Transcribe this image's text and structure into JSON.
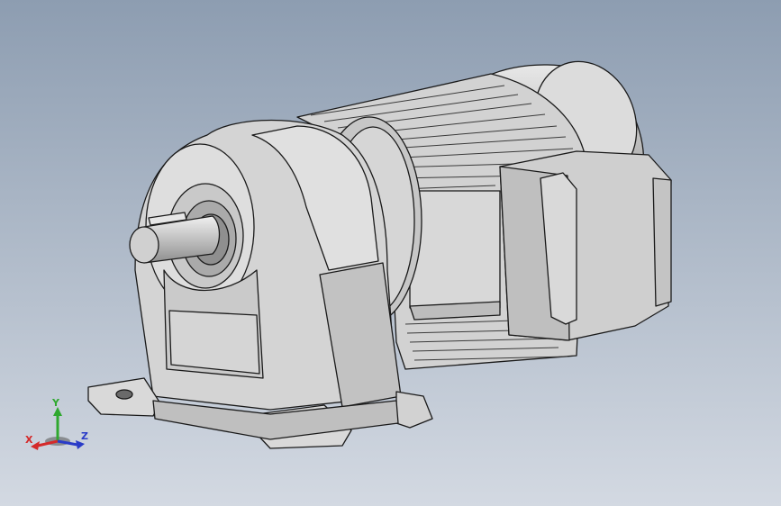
{
  "viewport": {
    "background_top": "#8a9bb0",
    "background_bottom": "#d0d7e1",
    "model_description_hidden": ""
  },
  "triad": {
    "x_label": "X",
    "y_label": "Y",
    "z_label": "Z",
    "x_color": "#d42a2a",
    "y_color": "#2fa82f",
    "z_color": "#2a3cc8"
  },
  "model": {
    "body_color": "#c8c8c8",
    "edge_color": "#1a1a1a"
  }
}
